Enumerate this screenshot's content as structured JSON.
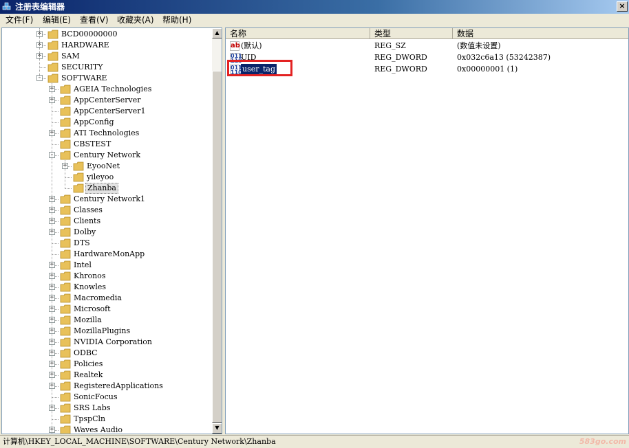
{
  "window": {
    "title": "注册表编辑器",
    "close_glyph": "×"
  },
  "menu": [
    "文件(F)",
    "编辑(E)",
    "查看(V)",
    "收藏夹(A)",
    "帮助(H)"
  ],
  "tree": {
    "items": [
      {
        "label": "BCD00000000",
        "level": 1,
        "expandable": true
      },
      {
        "label": "HARDWARE",
        "level": 1,
        "expandable": true
      },
      {
        "label": "SAM",
        "level": 1,
        "expandable": true
      },
      {
        "label": "SECURITY",
        "level": 1,
        "expandable": false
      },
      {
        "label": "SOFTWARE",
        "level": 1,
        "expandable": true,
        "expanded": true
      },
      {
        "label": "AGEIA Technologies",
        "level": 2,
        "expandable": true
      },
      {
        "label": "AppCenterServer",
        "level": 2,
        "expandable": true
      },
      {
        "label": "AppCenterServer1",
        "level": 2,
        "expandable": false
      },
      {
        "label": "AppConfig",
        "level": 2,
        "expandable": false
      },
      {
        "label": "ATI Technologies",
        "level": 2,
        "expandable": true
      },
      {
        "label": "CBSTEST",
        "level": 2,
        "expandable": false
      },
      {
        "label": "Century Network",
        "level": 2,
        "expandable": true,
        "expanded": true
      },
      {
        "label": "EyooNet",
        "level": 3,
        "expandable": true
      },
      {
        "label": "yileyoo",
        "level": 3,
        "expandable": false
      },
      {
        "label": "Zhanba",
        "level": 3,
        "expandable": false,
        "selected": true
      },
      {
        "label": "Century Network1",
        "level": 2,
        "expandable": true
      },
      {
        "label": "Classes",
        "level": 2,
        "expandable": true
      },
      {
        "label": "Clients",
        "level": 2,
        "expandable": true
      },
      {
        "label": "Dolby",
        "level": 2,
        "expandable": true
      },
      {
        "label": "DTS",
        "level": 2,
        "expandable": false
      },
      {
        "label": "HardwareMonApp",
        "level": 2,
        "expandable": false
      },
      {
        "label": "Intel",
        "level": 2,
        "expandable": true
      },
      {
        "label": "Khronos",
        "level": 2,
        "expandable": true
      },
      {
        "label": "Knowles",
        "level": 2,
        "expandable": true
      },
      {
        "label": "Macromedia",
        "level": 2,
        "expandable": true
      },
      {
        "label": "Microsoft",
        "level": 2,
        "expandable": true
      },
      {
        "label": "Mozilla",
        "level": 2,
        "expandable": true
      },
      {
        "label": "MozillaPlugins",
        "level": 2,
        "expandable": true
      },
      {
        "label": "NVIDIA Corporation",
        "level": 2,
        "expandable": true
      },
      {
        "label": "ODBC",
        "level": 2,
        "expandable": true
      },
      {
        "label": "Policies",
        "level": 2,
        "expandable": true
      },
      {
        "label": "Realtek",
        "level": 2,
        "expandable": true
      },
      {
        "label": "RegisteredApplications",
        "level": 2,
        "expandable": true
      },
      {
        "label": "SonicFocus",
        "level": 2,
        "expandable": false
      },
      {
        "label": "SRS Labs",
        "level": 2,
        "expandable": true
      },
      {
        "label": "TpspCln",
        "level": 2,
        "expandable": false
      },
      {
        "label": "Waves Audio",
        "level": 2,
        "expandable": true
      }
    ]
  },
  "list": {
    "columns": {
      "name": "名称",
      "type": "类型",
      "data": "数据"
    },
    "rows": [
      {
        "icon": "string-value-icon",
        "icon_text": "ab",
        "name": "(默认)",
        "type": "REG_SZ",
        "data": "(数值未设置)"
      },
      {
        "icon": "dword-value-icon",
        "icon_text": "011 110",
        "name": "UID",
        "type": "REG_DWORD",
        "data": "0x032c6a13 (53242387)"
      },
      {
        "icon": "dword-value-icon",
        "icon_text": "011 110",
        "name": "user_tag",
        "type": "REG_DWORD",
        "data": "0x00000001 (1)",
        "selected": true
      }
    ]
  },
  "status": {
    "path": "计算机\\HKEY_LOCAL_MACHINE\\SOFTWARE\\Century Network\\Zhanba",
    "watermark": "583go.com"
  },
  "colors": {
    "title_bar": "#0a246a",
    "selection": "#0a246a",
    "highlight_box": "#e32222",
    "folder": "#e8c15a"
  }
}
